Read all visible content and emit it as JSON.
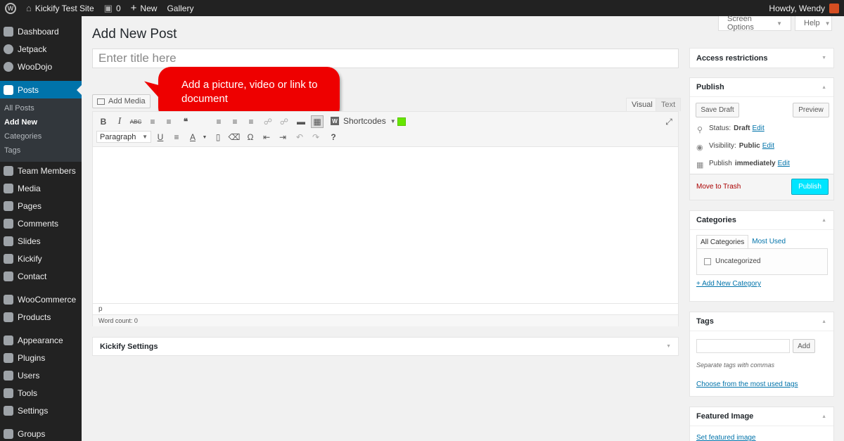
{
  "adminbar": {
    "site_name": "Kickify Test Site",
    "comments_count": "0",
    "new_label": "New",
    "gallery_label": "Gallery",
    "howdy": "Howdy, Wendy"
  },
  "sidebar": {
    "items": [
      {
        "label": "Dashboard",
        "icon": "dashboard-icon"
      },
      {
        "label": "Jetpack",
        "icon": "jetpack-icon"
      },
      {
        "label": "WooDojo",
        "icon": "woodojo-icon"
      },
      {
        "label": "Posts",
        "icon": "pin-icon"
      },
      {
        "label": "Team Members",
        "icon": "team-icon"
      },
      {
        "label": "Media",
        "icon": "media-icon"
      },
      {
        "label": "Pages",
        "icon": "pages-icon"
      },
      {
        "label": "Comments",
        "icon": "comments-icon"
      },
      {
        "label": "Slides",
        "icon": "slides-icon"
      },
      {
        "label": "Kickify",
        "icon": "kickify-icon"
      },
      {
        "label": "Contact",
        "icon": "contact-icon"
      },
      {
        "label": "WooCommerce",
        "icon": "woocommerce-icon"
      },
      {
        "label": "Products",
        "icon": "products-icon"
      },
      {
        "label": "Appearance",
        "icon": "appearance-icon"
      },
      {
        "label": "Plugins",
        "icon": "plugins-icon"
      },
      {
        "label": "Users",
        "icon": "users-icon"
      },
      {
        "label": "Tools",
        "icon": "tools-icon"
      },
      {
        "label": "Settings",
        "icon": "settings-icon"
      },
      {
        "label": "Groups",
        "icon": "groups-icon"
      }
    ],
    "posts_submenu": [
      "All Posts",
      "Add New",
      "Categories",
      "Tags"
    ]
  },
  "header": {
    "screen_options": "Screen Options",
    "help": "Help",
    "page_title": "Add New Post"
  },
  "editor": {
    "title_placeholder": "Enter title here",
    "add_media": "Add Media",
    "callout": "Add a picture, video or link to document",
    "tab_visual": "Visual",
    "tab_text": "Text",
    "format_select": "Paragraph",
    "shortcodes": "Shortcodes",
    "path": "p",
    "word_count": "Word count: 0"
  },
  "kickify_settings": "Kickify Settings",
  "access": {
    "title": "Access restrictions"
  },
  "publish": {
    "title": "Publish",
    "save_draft": "Save Draft",
    "preview": "Preview",
    "status_label": "Status:",
    "status_value": "Draft",
    "visibility_label": "Visibility:",
    "visibility_value": "Public",
    "publish_label": "Publish",
    "publish_value": "immediately",
    "edit": "Edit",
    "move_to_trash": "Move to Trash",
    "publish_button": "Publish"
  },
  "categories": {
    "title": "Categories",
    "tab_all": "All Categories",
    "tab_most_used": "Most Used",
    "items": [
      "Uncategorized"
    ],
    "add_new": "+ Add New Category"
  },
  "tags": {
    "title": "Tags",
    "add_button": "Add",
    "hint": "Separate tags with commas",
    "choose_link": "Choose from the most used tags"
  },
  "featured_image": {
    "title": "Featured Image",
    "set_link": "Set featured image"
  },
  "colors": {
    "adminbar": "#222222",
    "accent": "#0073aa",
    "callout": "#ee0000",
    "publish_button": "#00e5ff"
  }
}
